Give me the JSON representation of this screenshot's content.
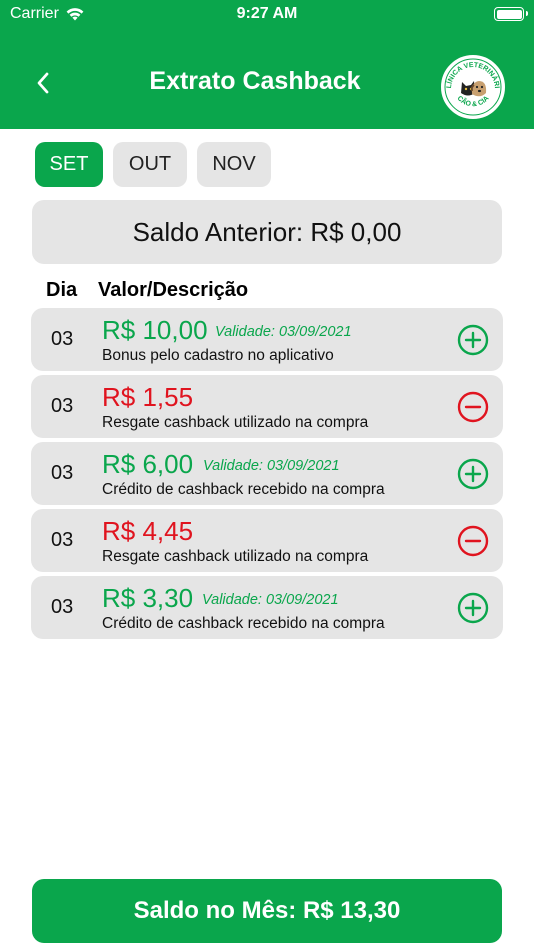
{
  "status_bar": {
    "carrier": "Carrier",
    "time": "9:27 AM"
  },
  "header": {
    "title": "Extrato Cashback",
    "logo_text_top": "CLÍNICA VETERINÁRIA",
    "logo_text_bottom": "CÃO & CIA"
  },
  "tabs": [
    {
      "label": "SET",
      "active": true
    },
    {
      "label": "OUT",
      "active": false
    },
    {
      "label": "NOV",
      "active": false
    }
  ],
  "previous_balance": "Saldo Anterior: R$ 0,00",
  "columns": {
    "day": "Dia",
    "value_description": "Valor/Descrição"
  },
  "transactions": [
    {
      "day": "03",
      "amount": "R$ 10,00",
      "validity": "Validade: 03/09/2021",
      "description": "Bonus pelo cadastro no aplicativo",
      "type": "credit",
      "sign_icon": "plus-circle-icon"
    },
    {
      "day": "03",
      "amount": "R$ 1,55",
      "validity": "",
      "description": "Resgate cashback utilizado na compra",
      "type": "debit",
      "sign_icon": "minus-circle-icon"
    },
    {
      "day": "03",
      "amount": "R$ 6,00",
      "validity": "Validade: 03/09/2021",
      "description": "Crédito de cashback recebido na compra",
      "type": "credit",
      "sign_icon": "plus-circle-icon"
    },
    {
      "day": "03",
      "amount": "R$ 4,45",
      "validity": "",
      "description": "Resgate cashback utilizado na compra",
      "type": "debit",
      "sign_icon": "minus-circle-icon"
    },
    {
      "day": "03",
      "amount": "R$ 3,30",
      "validity": "Validade: 03/09/2021",
      "description": "Crédito de cashback recebido na compra",
      "type": "credit",
      "sign_icon": "plus-circle-icon"
    }
  ],
  "month_balance": "Saldo no Mês: R$ 13,30",
  "colors": {
    "primary": "#0aa64c",
    "debit": "#e0141f",
    "row_bg": "#e5e5e5"
  }
}
